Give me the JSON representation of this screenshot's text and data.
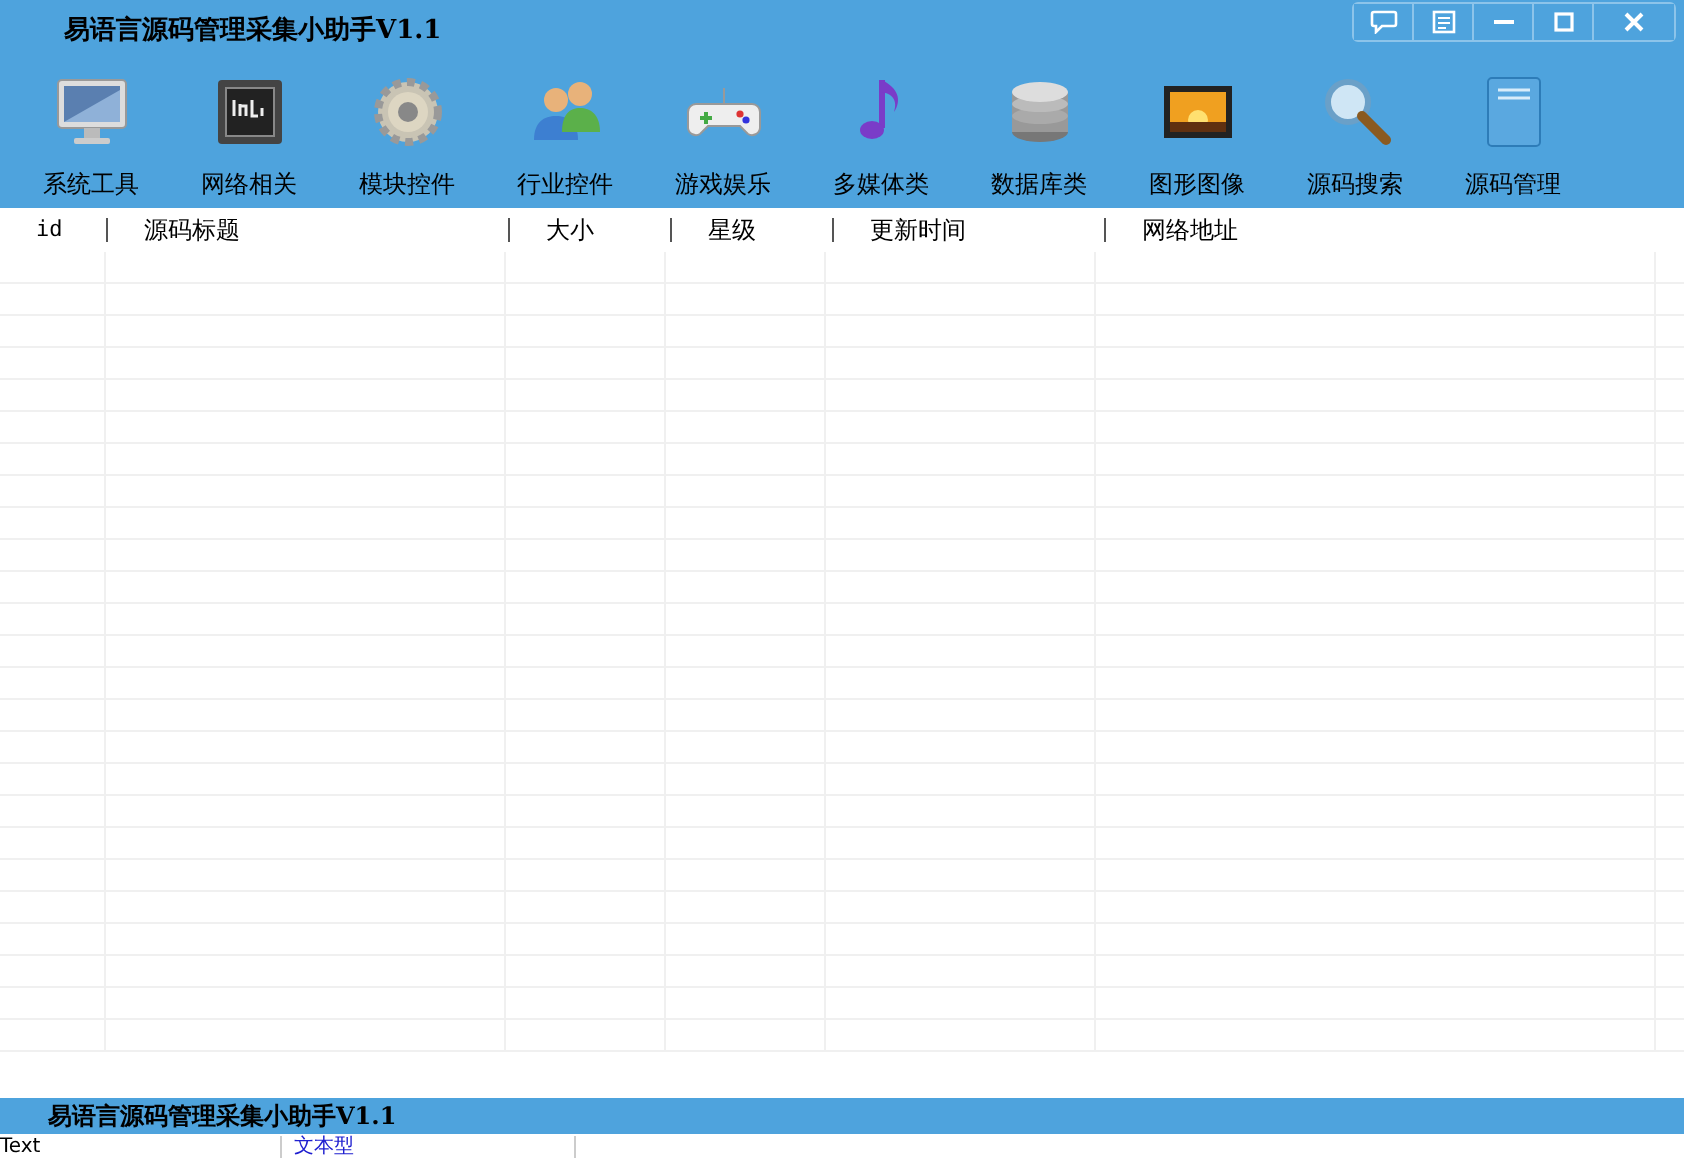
{
  "window": {
    "title": "易语言源码管理采集小助手V1.1"
  },
  "toolbar": [
    {
      "label": "系统工具"
    },
    {
      "label": "网络相关"
    },
    {
      "label": "模块控件"
    },
    {
      "label": "行业控件"
    },
    {
      "label": "游戏娱乐"
    },
    {
      "label": "多媒体类"
    },
    {
      "label": "数据库类"
    },
    {
      "label": "图形图像"
    },
    {
      "label": "源码搜索"
    },
    {
      "label": "源码管理"
    }
  ],
  "table": {
    "columns": [
      "id",
      "源码标题",
      "大小",
      "星级",
      "更新时间",
      "网络地址"
    ]
  },
  "status_bar": {
    "title": "易语言源码管理采集小助手V1.1"
  },
  "bottom_row": [
    "Text",
    "文本型"
  ]
}
